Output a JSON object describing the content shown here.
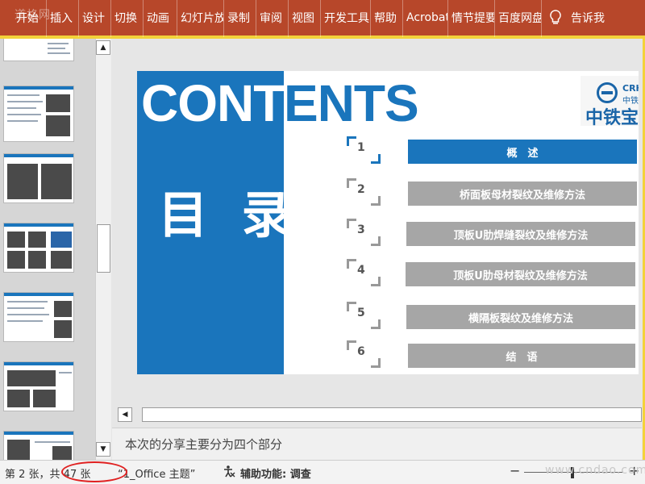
{
  "ribbon": {
    "tabs": [
      "开始",
      "插入",
      "设计",
      "切换",
      "动画",
      "幻灯片放映",
      "录制",
      "审阅",
      "视图",
      "开发工具",
      "帮助",
      "Acrobat",
      "情节提要",
      "百度网盘"
    ],
    "tell_me": "告诉我",
    "colors": {
      "ribbon": "#b7472a",
      "frame": "#f3d23a"
    }
  },
  "slide": {
    "contents_white": "CONT",
    "contents_blue": "ENTS",
    "mulu": "目 录",
    "logo": {
      "en": "CRH",
      "cn_small": "中铁",
      "cn": "中铁宝"
    },
    "toc": [
      {
        "num": "1",
        "label": "概　述",
        "active": true
      },
      {
        "num": "2",
        "label": "桥面板母材裂纹及维修方法",
        "active": false
      },
      {
        "num": "3",
        "label": "顶板U肋焊缝裂纹及维修方法",
        "active": false
      },
      {
        "num": "4",
        "label": "顶板U肋母材裂纹及维修方法",
        "active": false
      },
      {
        "num": "5",
        "label": "横隔板裂纹及维修方法",
        "active": false
      },
      {
        "num": "6",
        "label": "结　语",
        "active": false
      }
    ],
    "colors": {
      "accent": "#1a75bc",
      "inactive": "#a6a6a6"
    }
  },
  "notes": "本次的分享主要分为四个部分",
  "status": {
    "slide_count": "第 2 张，共 47 张",
    "theme": "“1_Office 主题”",
    "accessibility": "辅助功能: 调查"
  },
  "watermarks": {
    "top_left": "道格网",
    "bottom_right": "www.cndao.com"
  }
}
